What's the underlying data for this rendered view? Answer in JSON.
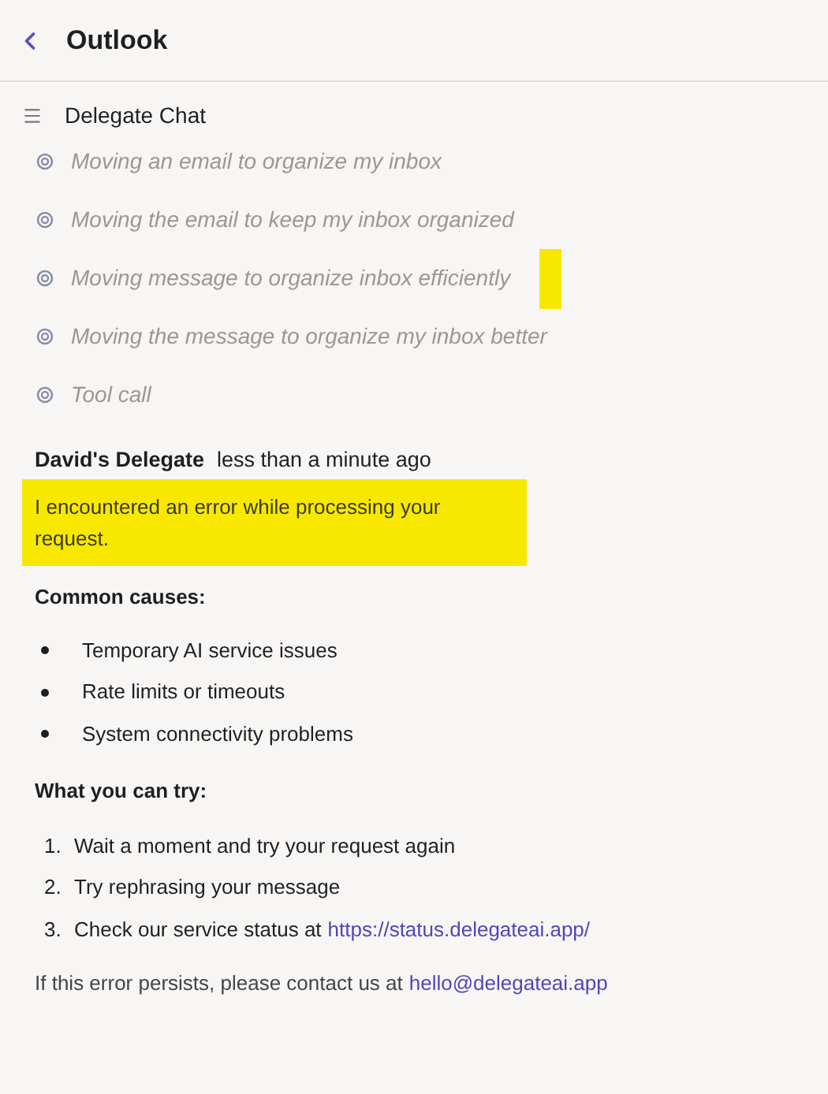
{
  "header": {
    "title": "Outlook"
  },
  "chat": {
    "title": "Delegate Chat"
  },
  "steps": [
    "Moving an email to organize my inbox",
    "Moving the email to keep my inbox organized",
    "Moving message to organize inbox efficiently",
    "Moving the message to organize my inbox better",
    "Tool call"
  ],
  "message": {
    "author": "David's Delegate",
    "time": "less than a minute ago",
    "error": "I encountered an error while processing your request.",
    "causes_heading": "Common causes:",
    "causes": [
      "Temporary AI service issues",
      "Rate limits or timeouts",
      "System connectivity problems"
    ],
    "try_heading": "What you can try:",
    "tries": [
      {
        "number": "1.",
        "text": "Wait a moment and try your request again"
      },
      {
        "number": "2.",
        "text": "Try rephrasing your message"
      },
      {
        "number": "3.",
        "text": "Check our service status at",
        "link": "https://status.delegateai.app/"
      }
    ],
    "contact": {
      "text": "If this error persists, please contact us at",
      "link": "hello@delegateai.app"
    }
  }
}
